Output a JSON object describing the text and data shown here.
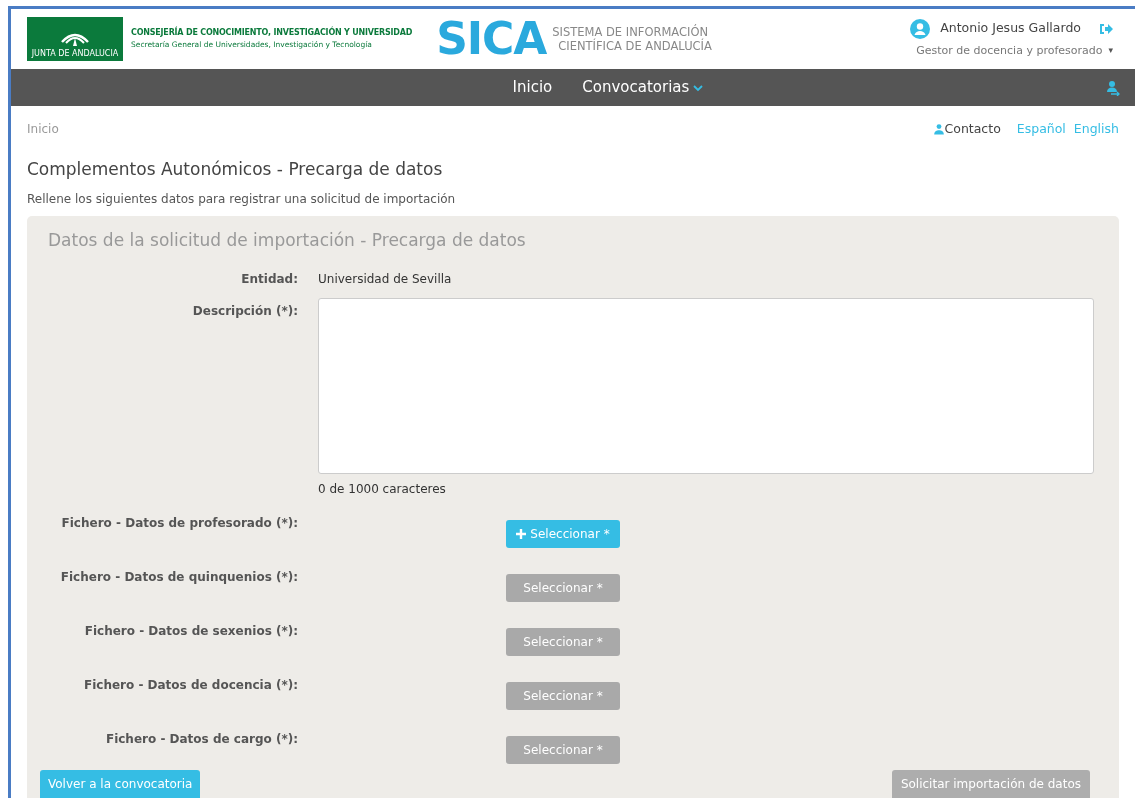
{
  "header": {
    "logo_caption": "JUNTA DE ANDALUCIA",
    "org_title": "CONSEJERÍA DE CONOCIMIENTO, INVESTIGACIÓN Y UNIVERSIDAD",
    "org_subtitle": "Secretaría General de Universidades, Investigación y Tecnología",
    "brand": "SICA",
    "brand_line1": "SISTEMA DE INFORMACIÓN",
    "brand_line2": "CIENTÍFICA DE ANDALUCÍA",
    "user_name": "Antonio Jesus Gallardo",
    "user_role": "Gestor de docencia y profesorado",
    "role_caret": "▾"
  },
  "nav": [
    {
      "label": "Inicio",
      "dropdown": false
    },
    {
      "label": "Convocatorias",
      "dropdown": true
    }
  ],
  "breadcrumb": "Inicio",
  "top_links": {
    "contact": "Contacto",
    "languages": [
      "Español",
      "English"
    ]
  },
  "page_title": "Complementos Autonómicos - Precarga de datos",
  "page_subtitle": "Rellene los siguientes datos para registrar una solicitud de importación",
  "panel": {
    "title": "Datos de la solicitud de importación - Precarga de datos",
    "entity_label": "Entidad:",
    "entity_value": "Universidad de Sevilla",
    "description_label": "Descripción (*):",
    "char_count": "0 de 1000 caracteres",
    "files": [
      {
        "label": "Fichero - Datos de profesorado (*):",
        "button": "Seleccionar *",
        "disabled": false
      },
      {
        "label": "Fichero - Datos de quinquenios (*):",
        "button": "Seleccionar *",
        "disabled": true
      },
      {
        "label": "Fichero - Datos de sexenios (*):",
        "button": "Seleccionar *",
        "disabled": true
      },
      {
        "label": "Fichero - Datos de docencia (*):",
        "button": "Seleccionar *",
        "disabled": true
      },
      {
        "label": "Fichero - Datos de cargo (*):",
        "button": "Seleccionar *",
        "disabled": true
      }
    ],
    "back_button": "Volver a la convocatoria",
    "submit_button": {
      "label": "Solicitar importación de datos",
      "disabled": true
    }
  }
}
